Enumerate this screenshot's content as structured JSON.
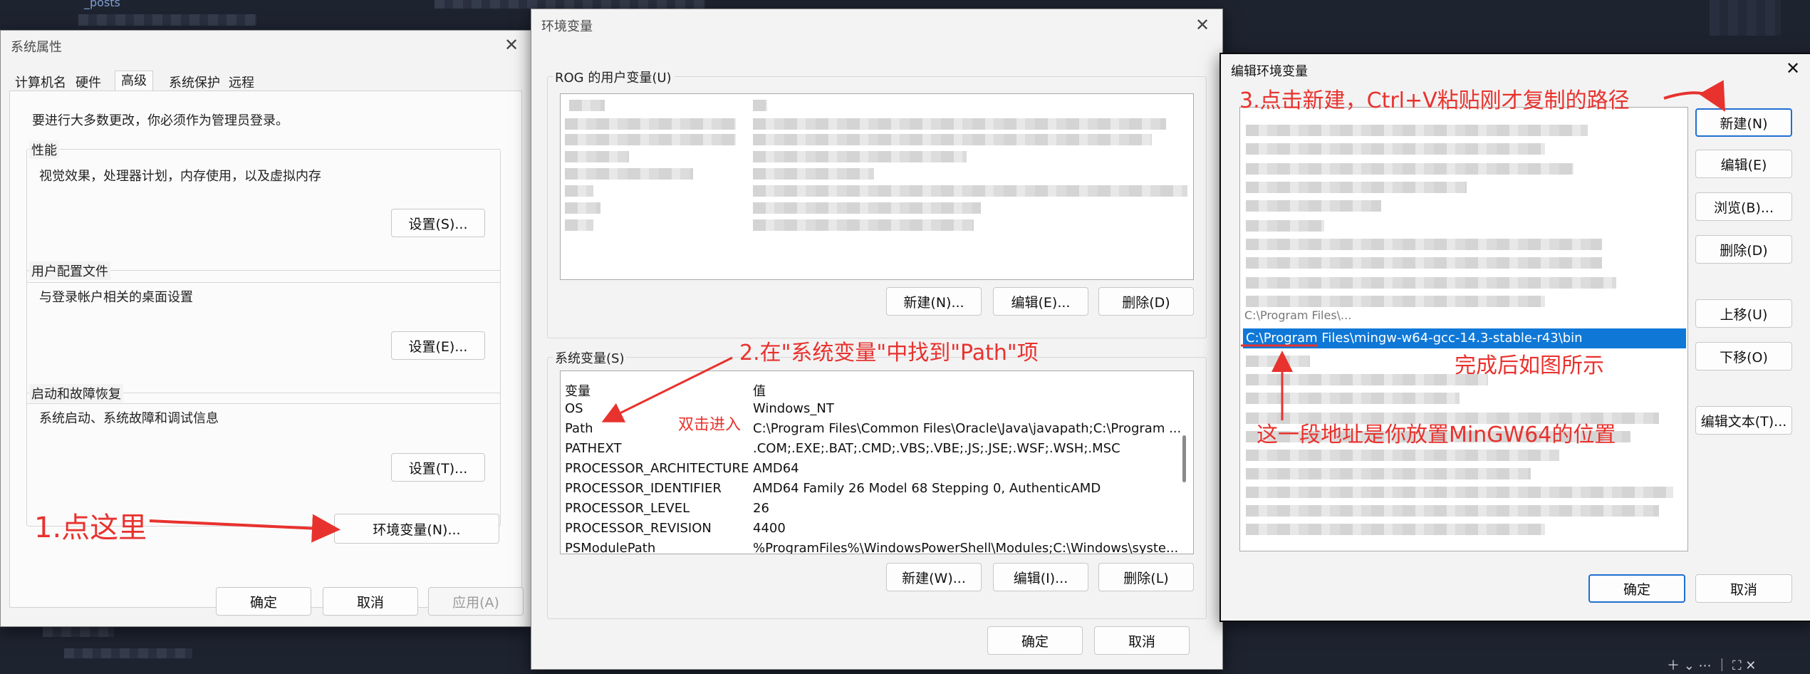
{
  "background": {
    "top_text": "_posts"
  },
  "sysprops": {
    "title": "系统属性",
    "tabs": [
      "计算机名",
      "硬件",
      "高级",
      "系统保护",
      "远程"
    ],
    "note": "要进行大多数更改，你必须作为管理员登录。",
    "perf": {
      "label": "性能",
      "desc": "视觉效果，处理器计划，内存使用，以及虚拟内存",
      "button": "设置(S)..."
    },
    "profile": {
      "label": "用户配置文件",
      "desc": "与登录帐户相关的桌面设置",
      "button": "设置(E)..."
    },
    "startup": {
      "label": "启动和故障恢复",
      "desc": "系统启动、系统故障和调试信息",
      "button": "设置(T)..."
    },
    "envvars_button": "环境变量(N)...",
    "ok": "确定",
    "cancel": "取消",
    "apply": "应用(A)"
  },
  "envvars": {
    "title": "环境变量",
    "user_group": "ROG 的用户变量(U)",
    "user_buttons": [
      "新建(N)...",
      "编辑(E)...",
      "删除(D)"
    ],
    "sys_group": "系统变量(S)",
    "columns": [
      "变量",
      "值"
    ],
    "rows": [
      [
        "OS",
        "Windows_NT"
      ],
      [
        "Path",
        "C:\\Program Files\\Common Files\\Oracle\\Java\\javapath;C:\\Program ..."
      ],
      [
        "PATHEXT",
        ".COM;.EXE;.BAT;.CMD;.VBS;.VBE;.JS;.JSE;.WSF;.WSH;.MSC"
      ],
      [
        "PROCESSOR_ARCHITECTURE",
        "AMD64"
      ],
      [
        "PROCESSOR_IDENTIFIER",
        "AMD64 Family 26 Model 68 Stepping 0, AuthenticAMD"
      ],
      [
        "PROCESSOR_LEVEL",
        "26"
      ],
      [
        "PROCESSOR_REVISION",
        "4400"
      ],
      [
        "PSModulePath",
        "%ProgramFiles%\\WindowsPowerShell\\Modules;C:\\Windows\\syste..."
      ]
    ],
    "sys_buttons": [
      "新建(W)...",
      "编辑(I)...",
      "删除(L)"
    ],
    "ok": "确定",
    "cancel": "取消"
  },
  "editenv": {
    "title": "编辑环境变量",
    "selected_entry": "C:\\Program Files\\mingw-w64-gcc-14.3-stable-r43\\bin",
    "partial_entry": "C:\\Program Files\\...",
    "buttons": [
      "新建(N)",
      "编辑(E)",
      "浏览(B)...",
      "删除(D)",
      "上移(U)",
      "下移(O)",
      "编辑文本(T)..."
    ],
    "ok": "确定",
    "cancel": "取消"
  },
  "annotations": {
    "step1": "1.点这里",
    "step2": "2.在\"系统变量\"中找到\"Path\"项",
    "double_click": "双击进入",
    "step3": "3.点击新建，Ctrl+V粘贴刚才复制的路径",
    "done": "完成后如图所示",
    "location": "这一段地址是你放置MinGW64的位置"
  },
  "colors": {
    "annotation": "#e8322e",
    "selection": "#0f78d7",
    "primary_border": "#1f6fd1"
  }
}
